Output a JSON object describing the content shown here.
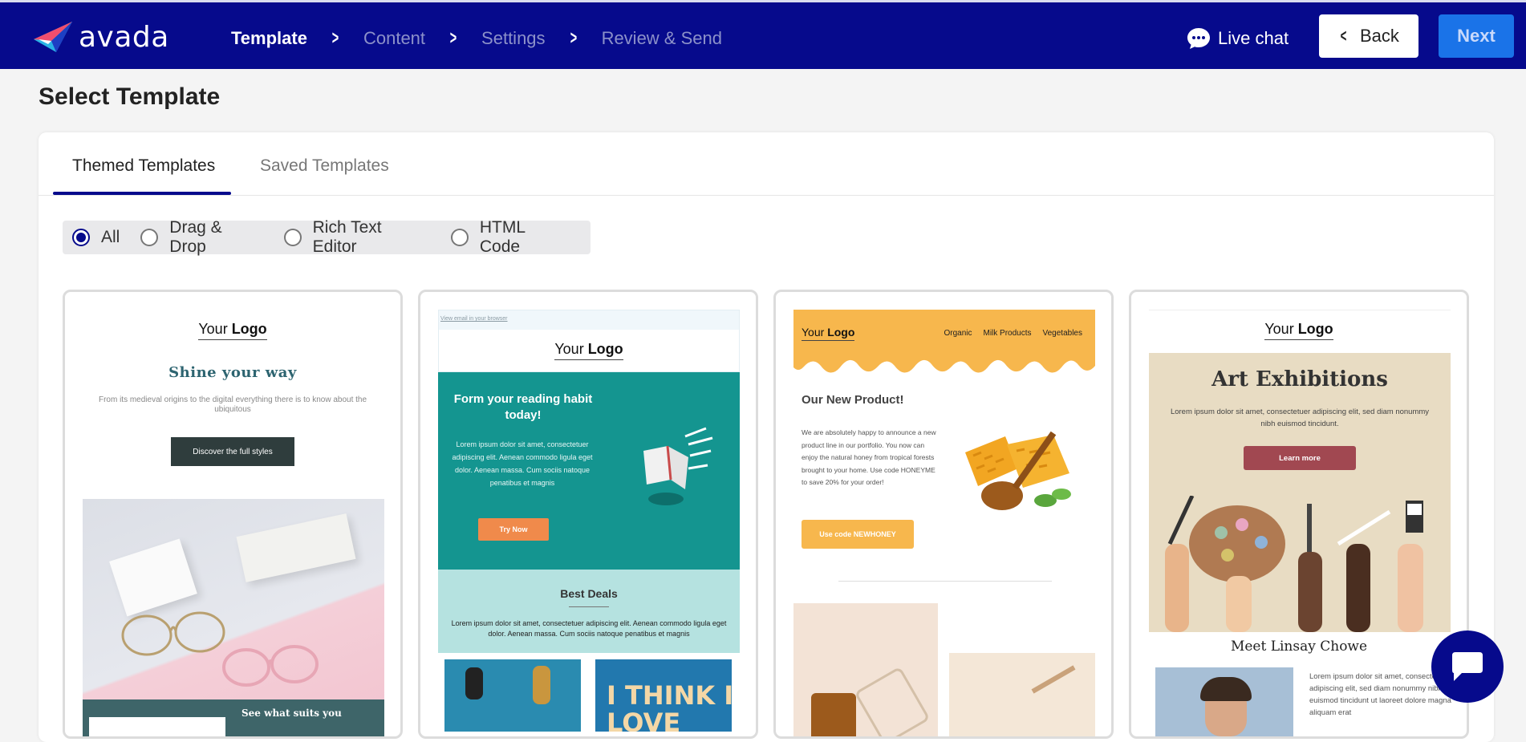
{
  "brand": {
    "name": "avada"
  },
  "steps": [
    {
      "label": "Template"
    },
    {
      "label": "Content"
    },
    {
      "label": "Settings"
    },
    {
      "label": "Review & Send"
    }
  ],
  "header": {
    "live_chat": "Live chat",
    "back": "Back",
    "next": "Next"
  },
  "page": {
    "title": "Select Template"
  },
  "tabs": [
    {
      "label": "Themed Templates"
    },
    {
      "label": "Saved Templates"
    }
  ],
  "filters": [
    {
      "label": "All",
      "selected": true
    },
    {
      "label": "Drag & Drop"
    },
    {
      "label": "Rich Text Editor"
    },
    {
      "label": "HTML Code"
    }
  ],
  "cards": [
    {
      "logo_prefix": "Your ",
      "logo_bold": "Logo",
      "heading": "Shine your way",
      "text": "From its medieval origins to the digital everything there is to know about the ubiquitous",
      "button": "Discover the full styles",
      "footer": "See what suits you"
    },
    {
      "view_link": "View email in your browser",
      "logo_prefix": "Your ",
      "logo_bold": "Logo",
      "heading": "Form your reading habit today!",
      "text": "Lorem ipsum dolor sit amet, consectetuer adipiscing elit. Aenean commodo ligula eget dolor. Aenean massa. Cum sociis natoque penatibus et magnis",
      "button": "Try Now",
      "deals_title": "Best Deals",
      "deals_text": "Lorem ipsum dolor sit amet, consectetuer adipiscing elit. Aenean commodo ligula eget dolor. Aenean massa. Cum sociis natoque penatibus et magnis",
      "book_text": "I THINK I LOVE"
    },
    {
      "logo_prefix": "Your ",
      "logo_bold": "Logo",
      "nav": [
        "Organic",
        "Milk Products",
        "Vegetables"
      ],
      "heading": "Our New Product!",
      "text": "We are absolutely happy to announce a new product line in our portfolio. You now can enjoy the natural honey from tropical forests brought to your home. Use code HONEYME to save 20% for your order!",
      "button": "Use code NEWHONEY"
    },
    {
      "logo_prefix": "Your ",
      "logo_bold": "Logo",
      "heading": "Art Exhibitions",
      "text": "Lorem ipsum dolor sit amet, consectetuer adipiscing elit, sed diam nonummy nibh euismod tincidunt.",
      "button": "Learn more",
      "subheading": "Meet Linsay Chowe",
      "bio": "Lorem ipsum dolor sit amet, consectetuer adipiscing elit, sed diam nonummy nibh euismod tincidunt ut laoreet dolore magna aliquam erat"
    }
  ],
  "colors": {
    "header_bg": "#060a8c",
    "next_button": "#1a73e8",
    "accent": "#060a8c"
  }
}
